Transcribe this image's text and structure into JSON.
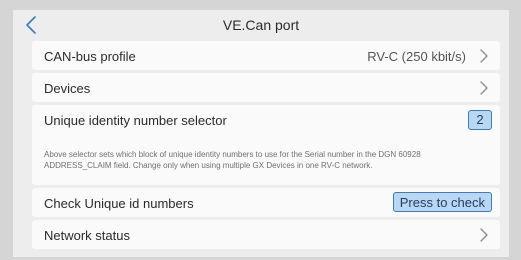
{
  "header": {
    "title": "VE.Can port",
    "back_icon": "chevron-left-icon"
  },
  "colors": {
    "accent": "#3a7ebf",
    "button_fill": "#b9d6f2",
    "background": "#ededed",
    "row_background": "#fafafa"
  },
  "rows": {
    "can_profile": {
      "label": "CAN-bus profile",
      "value": "RV-C (250 kbit/s)",
      "icon": "chevron-right-icon"
    },
    "devices": {
      "label": "Devices",
      "icon": "chevron-right-icon"
    },
    "unique_id": {
      "label": "Unique identity number selector",
      "value": "2",
      "description": "Above selector sets which block of unique identity numbers to use for the Serial number in the DGN 60928 ADDRESS_CLAIM field. Change only when using multiple GX Devices in one RV-C network."
    },
    "check_ids": {
      "label": "Check Unique id numbers",
      "button_label": "Press to check"
    },
    "network_status": {
      "label": "Network status",
      "icon": "chevron-right-icon"
    }
  }
}
